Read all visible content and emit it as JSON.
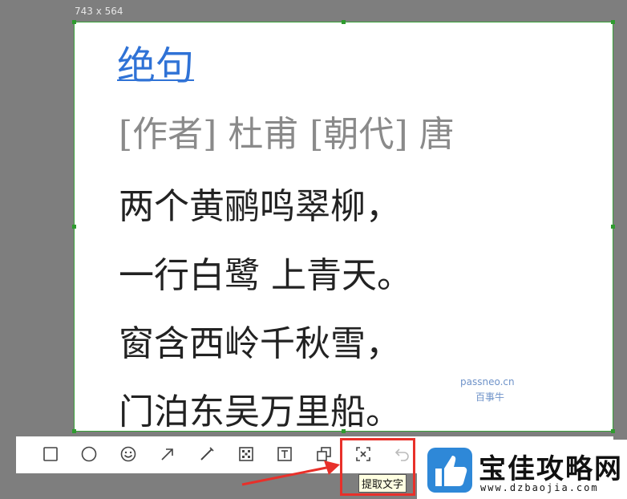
{
  "selection": {
    "size_label": "743 x 564"
  },
  "poem": {
    "title": "绝句",
    "meta": "[作者] 杜甫 [朝代]  唐",
    "lines": [
      "两个黄鹂鸣翠柳，",
      "一行白鹭 上青天。",
      "窗含西岭千秋雪，",
      "门泊东吴万里船。"
    ]
  },
  "watermark": {
    "line1": "passneo.cn",
    "line2": "百事牛"
  },
  "toolbar": {
    "items": [
      {
        "icon": "rectangle-icon"
      },
      {
        "icon": "circle-icon"
      },
      {
        "icon": "emoji-icon"
      },
      {
        "icon": "arrow-icon"
      },
      {
        "icon": "pen-icon"
      },
      {
        "icon": "mosaic-icon"
      },
      {
        "icon": "text-icon"
      },
      {
        "icon": "sticker-icon"
      },
      {
        "icon": "extract-text-icon"
      },
      {
        "icon": "undo-icon"
      }
    ],
    "tooltip": "提取文字"
  },
  "logo": {
    "name": "宝佳攻略网",
    "url": "www.dzbaojia.com"
  },
  "colors": {
    "accent": "#2f72d6",
    "highlight": "#e8302a",
    "selection_border": "#3aa13a"
  }
}
